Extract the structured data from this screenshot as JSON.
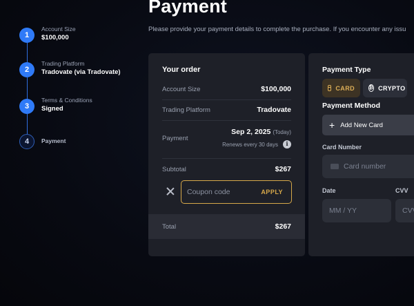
{
  "header": {
    "title": "Payment",
    "subtitle": "Please provide your payment details to complete the purchase. If you encounter any issu"
  },
  "stepper": {
    "steps": [
      {
        "number": "1",
        "label": "Account Size",
        "value": "$100,000",
        "status": "complete"
      },
      {
        "number": "2",
        "label": "Trading Platform",
        "value": "Tradovate (via Tradovate)",
        "status": "complete"
      },
      {
        "number": "3",
        "label": "Terms & Conditions",
        "value": "Signed",
        "status": "complete"
      },
      {
        "number": "4",
        "label": "Payment",
        "value": "",
        "status": "current"
      }
    ]
  },
  "order": {
    "title": "Your order",
    "account_size_label": "Account Size",
    "account_size_value": "$100,000",
    "platform_label": "Trading Platform",
    "platform_value": "Tradovate",
    "payment_label": "Payment",
    "payment_date": "Sep 2, 2025",
    "payment_today": "(Today)",
    "renews": "Renews every 30 days",
    "subtotal_label": "Subtotal",
    "subtotal_value": "$267",
    "coupon_placeholder": "Coupon code",
    "apply_label": "APPLY",
    "total_label": "Total",
    "total_value": "$267"
  },
  "payment": {
    "type_title": "Payment Type",
    "card_label": "CARD",
    "crypto_label": "CRYPTO",
    "method_title": "Payment Method",
    "add_card_label": "Add New Card",
    "card_number_label": "Card Number",
    "card_number_placeholder": "Card number",
    "date_label": "Date",
    "date_placeholder": "MM / YY",
    "cvv_label": "CVV",
    "cvv_placeholder": "CVV"
  },
  "colors": {
    "accent_blue": "#2f7af7",
    "accent_gold": "#d8a94a",
    "card_bg": "#1e2028"
  },
  "icons": [
    "close-icon",
    "info-icon",
    "card-icon",
    "crypto-coin-icon",
    "plus-icon",
    "credit-card-icon"
  ]
}
